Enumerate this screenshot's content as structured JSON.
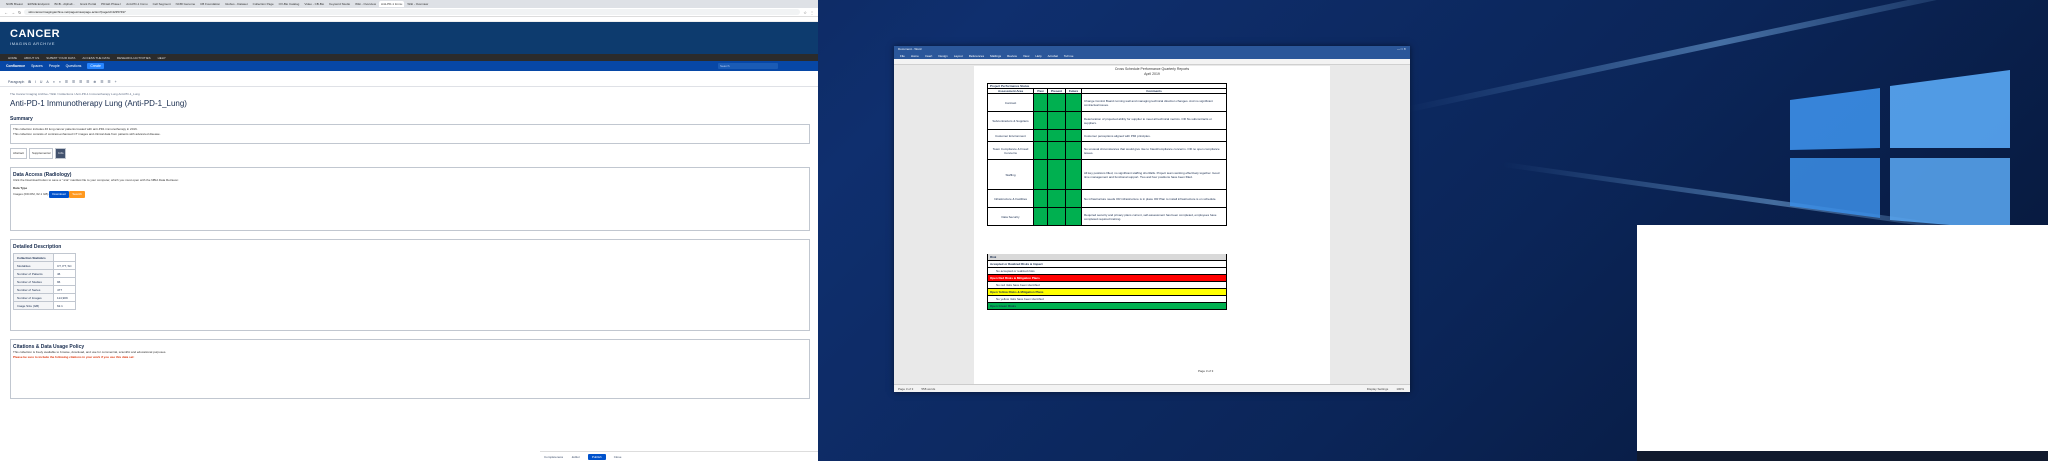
{
  "browser": {
    "tabs": [
      "NCBI Breast",
      "ERNIE Endpoint",
      "BCB - AlphaF...",
      "Grant Portal",
      "PD1ab Phase I",
      "Anti-PD-1 Immu",
      "Cell Segment",
      "NCBI Genome",
      "CB Foundation",
      "Globus - Dataset",
      "Collection Page",
      "OV-Bio Catalog",
      "Video - CB-Bio",
      "Keyword Studio",
      "Wiki - Overview",
      "Anti-PD-1 Immu",
      "Wiki - Overview"
    ],
    "url": "wiki.cancerimagingarchive.net/pages/viewpage.action?pageId=42357497",
    "tcia_logo": "CANCER",
    "tcia_sub": "IMAGING ARCHIVE",
    "nav": [
      "HOME",
      "ABOUT US",
      "SUBMIT YOUR DATA",
      "ACCESS THE DATA",
      "RESEARCH ACTIVITIES",
      "HELP"
    ],
    "confluence": {
      "brand": "Confluence",
      "menu": [
        "Spaces",
        "People",
        "Questions"
      ],
      "create": "Create",
      "search": "Search"
    },
    "editor_tools": [
      "Paragraph",
      "B",
      "I",
      "U",
      "A",
      "≡",
      "≡",
      "☰",
      "☰",
      "☰",
      "☰",
      "⊕",
      "☰",
      "☰",
      "+"
    ],
    "breadcrumb": "The Cancer Imaging Archive / Wiki / Collections / Anti-PD-1 Immunotherapy Lung Anti-PD-1_Lung",
    "page_title": "Anti-PD-1 Immunotherapy Lung (Anti-PD-1_Lung)",
    "summary_heading": "Summary",
    "summary_text1": "This collection includes 46 lung cancer patients treated with anti-PD1 immunotherapy in 2016.",
    "summary_text2": "This collection consists of contrast-enhanced CT images and clinical data from patients with advanced disease.",
    "chips": [
      "Abstract",
      "Supplemental",
      "Info"
    ],
    "data_access_heading": "Data Access (Radiology)",
    "data_access_text": "Click the Download button to save a \".tcia\" manifest file to your computer, which you must open with the NBIA Data Retriever.",
    "data_type": "Data Type",
    "data_row": "Images (DICOM, 62.1 GB)",
    "download_label": "Download",
    "search_label": "Search",
    "detailed_heading": "Detailed Description",
    "table": [
      [
        "Collection Statistics",
        ""
      ],
      [
        "Modalities",
        "CT, PT, SC"
      ],
      [
        "Number of Patients",
        "46"
      ],
      [
        "Number of Studies",
        "96"
      ],
      [
        "Number of Series",
        "477"
      ],
      [
        "Number of Images",
        "114,909"
      ],
      [
        "Image Size (GB)",
        "62.1"
      ]
    ],
    "citation_heading": "Citations & Data Usage Policy",
    "citation_text": "This collection is freely available to browse, download, and use for commercial, scientific and educational purposes.",
    "citation_warning": "Please be sure to include the following citations in your work if you use this data set:",
    "bottom": [
      "Completeness",
      ".Editor",
      "Publish",
      "Close"
    ]
  },
  "word": {
    "title": "Document - Word",
    "menu": [
      "File",
      "Home",
      "Insert",
      "Design",
      "Layout",
      "References",
      "Mailings",
      "Review",
      "View",
      "Help",
      "Acrobat",
      "Tell me"
    ],
    "header1": "Cross Schedule Performance Quarterly Reports",
    "header2": "April 2019",
    "table_title": "Project Performance Status",
    "cols": [
      "Assessment Area",
      "Past",
      "Present",
      "Future",
      "Comments"
    ],
    "rows": [
      [
        "Contract",
        "Change Control Board running well and managing technical direction changes. And no significant contractual issues."
      ],
      [
        "Subcontractors & Suppliers",
        "Deterioration of projected ability for supplier to meet all technical metrics. OR No subcontracts or suppliers."
      ],
      [
        "Customer Environment",
        "Customer perceptions aligned with PMI principles."
      ],
      [
        "Team Compliance & Fraud Concerns",
        "No unusual circumstances that would give rise to fraud/compliance concerns. OR no open compliance issues."
      ],
      [
        "Staffing",
        "All key positions filled, no significant staffing shortfalls. Project team working effectively together. Good time management and functional support.  Two and four positions have been filled."
      ],
      [
        "Infrastructure & Facilities",
        "No infrastructure needs OR infrastructure is in place OR Plan to install infrastructure is on schedule."
      ],
      [
        "Data Security",
        "Required security and privacy plans current, self-assessment has been completed, employees have completed required training."
      ]
    ],
    "risk": "Risk",
    "accepted": "Accepted or Realized Risks & Impact",
    "accepted_item": "No accepted or realized risks",
    "red_head": "Open Red Risks & Mitigation Plans",
    "red_item": "No red risks have been identified",
    "yellow_head": "Open Yellow Risks & Mitigation Plans",
    "yellow_item": "No yellow risks have been identified",
    "green_head": "Open Green Risks",
    "page_label": "Page 3 of 3",
    "status": [
      "Page 3 of 3",
      "558 words",
      "Display Settings",
      "100%"
    ],
    "colors": {
      "green": "#00b050",
      "red": "#ff0000",
      "yellow": "#ffff00",
      "word_blue": "#2b579a"
    }
  }
}
